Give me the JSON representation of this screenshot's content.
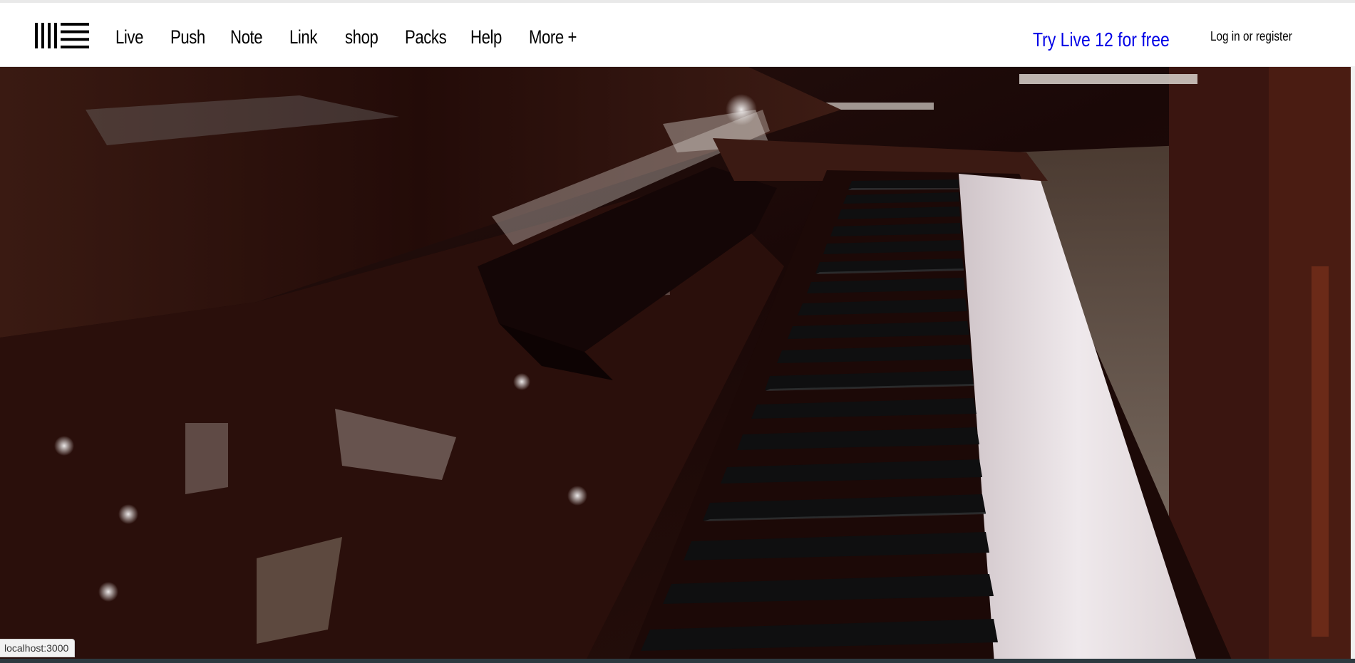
{
  "header": {
    "logo_icon": "ableton-logo-icon",
    "nav": [
      {
        "label": "Live"
      },
      {
        "label": "Push"
      },
      {
        "label": "Note"
      },
      {
        "label": "Link"
      },
      {
        "label": "shop"
      },
      {
        "label": "Packs"
      },
      {
        "label": "Help"
      },
      {
        "label": "More +"
      }
    ],
    "cta_label": "Try Live 12 for free",
    "auth": {
      "login_label": "Log in",
      "or_label": "or",
      "register_label": "register"
    }
  },
  "hero": {
    "image_icon": "piano-keyboard-photo"
  },
  "status_bar": {
    "url": "localhost:3000"
  },
  "colors": {
    "cta": "#0000e6",
    "text": "#000000",
    "background": "#ffffff"
  }
}
